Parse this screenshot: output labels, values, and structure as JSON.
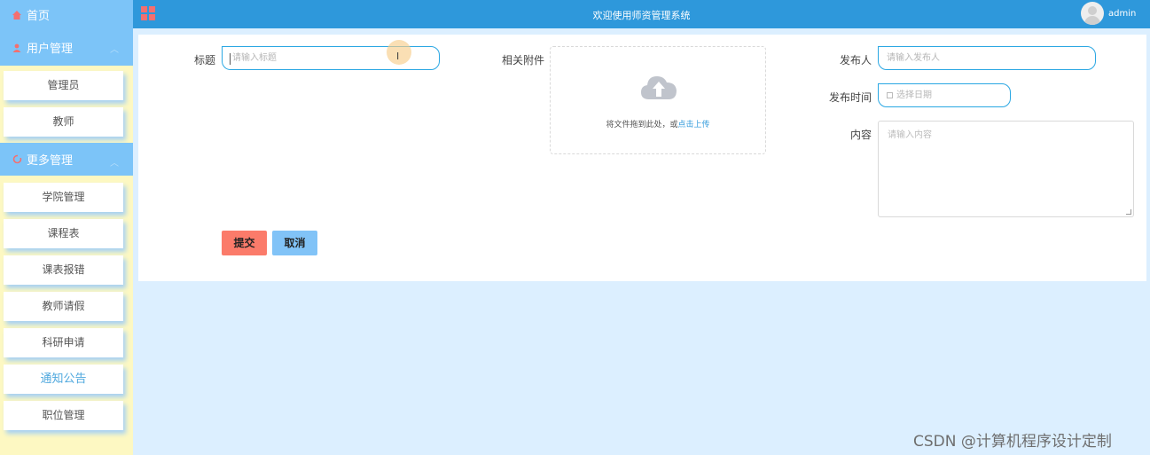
{
  "sidebar": {
    "home_label": "首页",
    "groups": [
      {
        "label": "用户管理",
        "items": [
          "管理员",
          "教师"
        ]
      },
      {
        "label": "更多管理",
        "items": [
          "学院管理",
          "课程表",
          "课表报错",
          "教师请假",
          "科研申请",
          "通知公告",
          "职位管理"
        ]
      }
    ],
    "active_item": "通知公告"
  },
  "header": {
    "title": "欢迎使用师资管理系统",
    "username": "admin"
  },
  "form": {
    "title_label": "标题",
    "title_placeholder": "请输入标题",
    "attachment_label": "相关附件",
    "upload_text": "将文件拖到此处，或",
    "upload_link": "点击上传",
    "publisher_label": "发布人",
    "publisher_placeholder": "请输入发布人",
    "publish_time_label": "发布时间",
    "publish_time_placeholder": "选择日期",
    "content_label": "内容",
    "content_placeholder": "请输入内容",
    "submit_label": "提交",
    "cancel_label": "取消"
  },
  "watermark": "CSDN @计算机程序设计定制",
  "colors": {
    "topbar": "#2e98db",
    "sidebar_header": "#7cc4f8",
    "sidebar_bg": "#fdf8c2",
    "submit": "#fb7b6a",
    "cancel": "#81c3f7"
  }
}
